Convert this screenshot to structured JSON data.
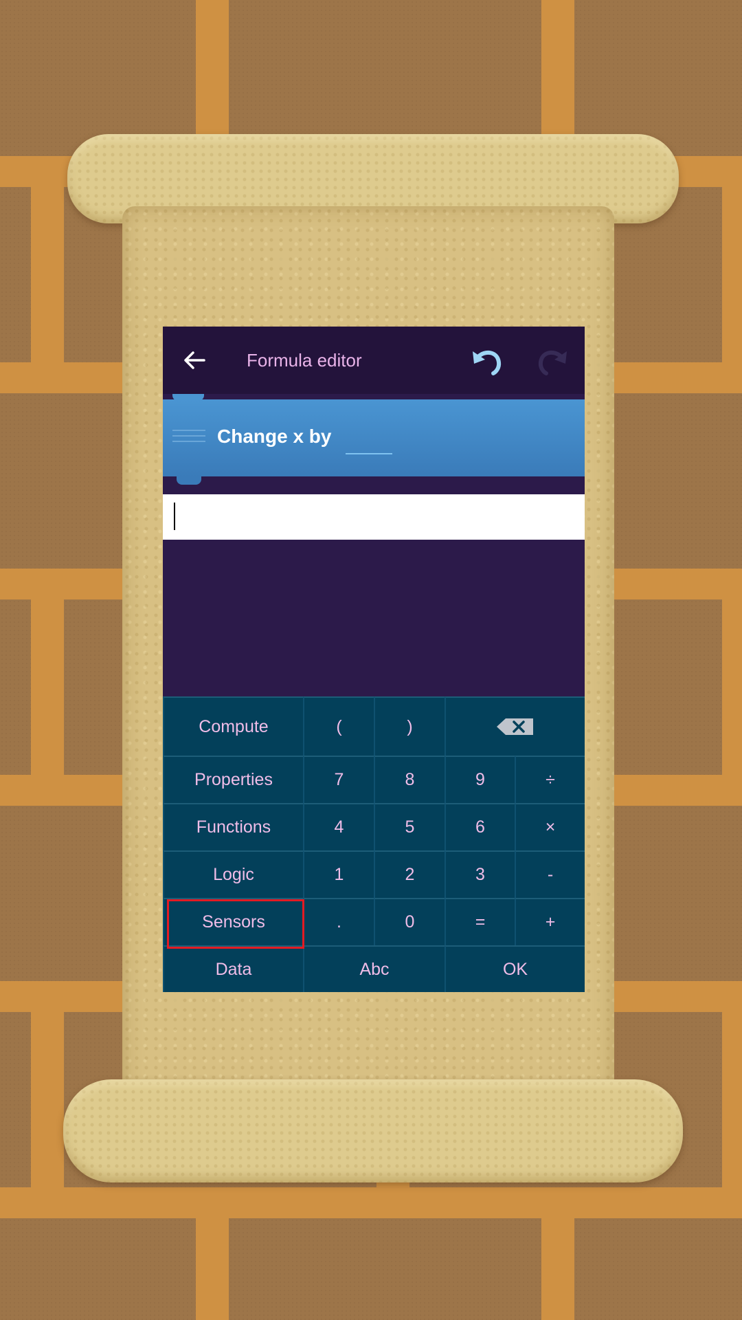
{
  "toolbar": {
    "title": "Formula editor",
    "back_icon": "arrow-left-icon",
    "undo_icon": "undo-icon",
    "redo_icon": "redo-icon"
  },
  "brick": {
    "label": "Change x by",
    "value": ""
  },
  "formula": {
    "value": ""
  },
  "keypad": {
    "compute": "Compute",
    "open_paren": "(",
    "close_paren": ")",
    "backspace_icon": "backspace-icon",
    "properties": "Properties",
    "functions": "Functions",
    "logic": "Logic",
    "sensors": "Sensors",
    "data": "Data",
    "abc": "Abc",
    "ok": "OK",
    "k7": "7",
    "k8": "8",
    "k9": "9",
    "div": "÷",
    "k4": "4",
    "k5": "5",
    "k6": "6",
    "mul": "×",
    "k1": "1",
    "k2": "2",
    "k3": "3",
    "minus": "-",
    "dot": ".",
    "k0": "0",
    "equals": "=",
    "plus": "+"
  },
  "colors": {
    "toolbar_bg": "#23133b",
    "app_bg": "#2c1a4a",
    "brick_blue": "#3f86c4",
    "key_bg": "#03405a",
    "key_text": "#f0bde8",
    "highlight": "#e31b23"
  }
}
